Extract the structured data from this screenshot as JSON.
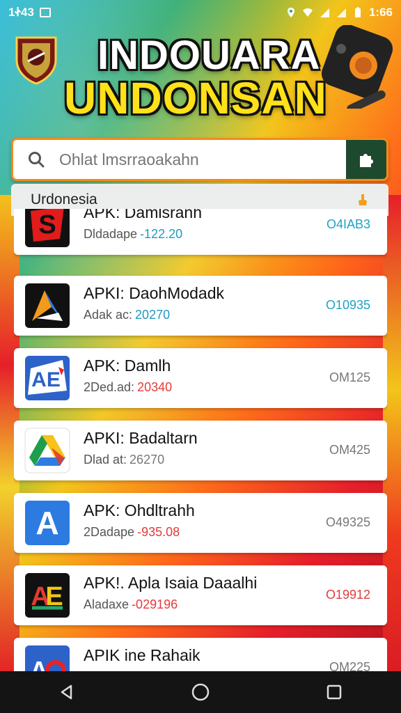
{
  "status_bar": {
    "time": "1Ꮠ43",
    "battery_time": "1:66"
  },
  "header": {
    "headline_line1": "INDOUARA",
    "headline_line2": "UNDONSAN"
  },
  "search": {
    "placeholder": "Ohlat lmsrraoakahn",
    "value": ""
  },
  "filter": {
    "selected": "Urdonesia"
  },
  "apps": [
    {
      "title": "APK: Damlsranh",
      "sub_label": "Dldadape",
      "sub_value": "-122.20",
      "sub_value_color": "#1e9ac2",
      "code": "O4IAB3",
      "code_color": "#1ea3c4",
      "icon": "s-logo-icon"
    },
    {
      "title": "APKI: DaohModadk",
      "sub_label": "Adak ac:",
      "sub_value": "20270",
      "sub_value_color": "#1e9ac2",
      "code": "O10935",
      "code_color": "#1ea3c4",
      "icon": "a-triangle-logo-icon"
    },
    {
      "title": "APK: Damlh",
      "sub_label": "2Ded.ad:",
      "sub_value": "20340",
      "sub_value_color": "#e33a3a",
      "code": "OM125",
      "code_color": "#777777",
      "icon": "ae-blue-logo-icon"
    },
    {
      "title": "APKI: Badaltarn",
      "sub_label": "Dlad at:",
      "sub_value": "26270",
      "sub_value_color": "#777777",
      "code": "OM425",
      "code_color": "#777777",
      "icon": "drive-logo-icon"
    },
    {
      "title": "APK: Ohdltrahh",
      "sub_label": "2Dadape",
      "sub_value": "-935.08",
      "sub_value_color": "#e33a3a",
      "code": "O49325",
      "code_color": "#777777",
      "icon": "a-blue-logo-icon"
    },
    {
      "title": "APK!. Apla Isaia Daaalhi",
      "sub_label": "Aladaxe",
      "sub_value": "-029196",
      "sub_value_color": "#e33a3a",
      "code": "O19912",
      "code_color": "#e33a3a",
      "icon": "ae-multicolor-logo-icon"
    },
    {
      "title": "APIK ine Rahaik",
      "sub_label": "",
      "sub_value": "",
      "sub_value_color": "#777777",
      "code": "OM225",
      "code_color": "#777777",
      "icon": "ao-logo-icon"
    }
  ]
}
